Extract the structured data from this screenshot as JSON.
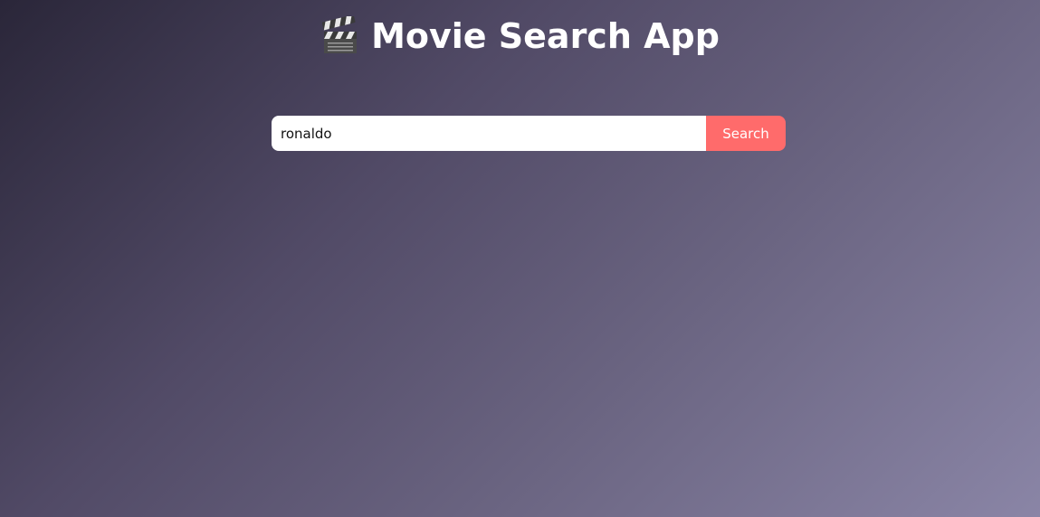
{
  "header": {
    "icon": "clapperboard-icon",
    "title": "Movie Search App"
  },
  "search": {
    "value": "ronaldo",
    "placeholder": "",
    "button_label": "Search"
  },
  "colors": {
    "accent": "#ff6b6b",
    "background_start": "#2a2639",
    "background_end": "#8a85a6"
  }
}
